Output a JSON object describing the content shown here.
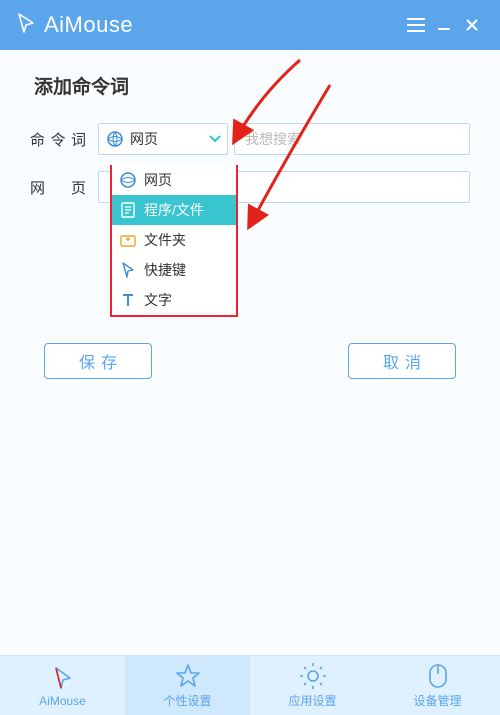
{
  "titlebar": {
    "app_name": "AiMouse"
  },
  "page": {
    "title": "添加命令词"
  },
  "fields": {
    "cmdword": {
      "label": "命令词",
      "selected": "网页",
      "placeholder": "我想搜索",
      "value": ""
    },
    "webpage": {
      "label": "网 页",
      "value": ""
    }
  },
  "dropdown": {
    "items": [
      {
        "label": "网页"
      },
      {
        "label": "程序/文件",
        "selected": true
      },
      {
        "label": "文件夹"
      },
      {
        "label": "快捷键"
      },
      {
        "label": "文字"
      }
    ]
  },
  "buttons": {
    "save": "保存",
    "cancel": "取消"
  },
  "nav": {
    "items": [
      {
        "label": "AiMouse"
      },
      {
        "label": "个性设置",
        "active": true
      },
      {
        "label": "应用设置"
      },
      {
        "label": "设备管理"
      }
    ]
  },
  "colors": {
    "accent": "#5ba5ec",
    "teal": "#39c5cf",
    "arrow": "#e2231a"
  }
}
